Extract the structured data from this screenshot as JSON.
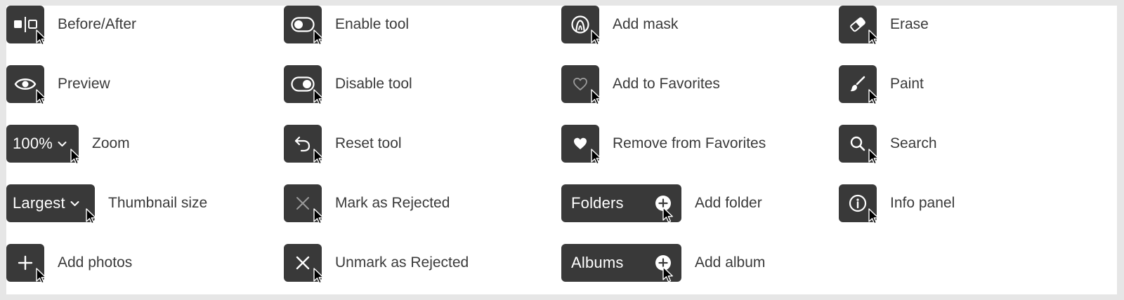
{
  "colors": {
    "button_bg": "#393939",
    "icon": "#ffffff",
    "label": "#3a3a3a",
    "page_bg": "#e6e6e6",
    "sheet_bg": "#ffffff"
  },
  "items": {
    "before_after": {
      "label": "Before/After",
      "icon": "before-after-icon"
    },
    "preview": {
      "label": "Preview",
      "icon": "eye-icon"
    },
    "zoom": {
      "label": "Zoom",
      "button_text": "100%",
      "icon": "chevron-down-icon"
    },
    "thumbnail_size": {
      "label": "Thumbnail size",
      "button_text": "Largest",
      "icon": "chevron-down-icon"
    },
    "add_photos": {
      "label": "Add photos",
      "icon": "plus-icon"
    },
    "enable_tool": {
      "label": "Enable tool",
      "icon": "toggle-off-icon"
    },
    "disable_tool": {
      "label": "Disable tool",
      "icon": "toggle-on-icon"
    },
    "reset_tool": {
      "label": "Reset tool",
      "icon": "undo-arrow-icon"
    },
    "mark_rejected": {
      "label": "Mark as Rejected",
      "icon": "x-icon"
    },
    "unmark_rejected": {
      "label": "Unmark as Rejected",
      "icon": "x-icon"
    },
    "add_mask": {
      "label": "Add mask",
      "icon": "mask-icon"
    },
    "add_favorites": {
      "label": "Add to Favorites",
      "icon": "heart-outline-icon"
    },
    "remove_favorites": {
      "label": "Remove from Favorites",
      "icon": "heart-filled-icon"
    },
    "add_folder": {
      "label": "Add folder",
      "button_text": "Folders",
      "icon": "plus-circle-icon"
    },
    "add_album": {
      "label": "Add album",
      "button_text": "Albums",
      "icon": "plus-circle-icon"
    },
    "erase": {
      "label": "Erase",
      "icon": "eraser-icon"
    },
    "paint": {
      "label": "Paint",
      "icon": "brush-icon"
    },
    "search": {
      "label": "Search",
      "icon": "search-icon"
    },
    "info_panel": {
      "label": "Info panel",
      "icon": "info-icon"
    }
  }
}
